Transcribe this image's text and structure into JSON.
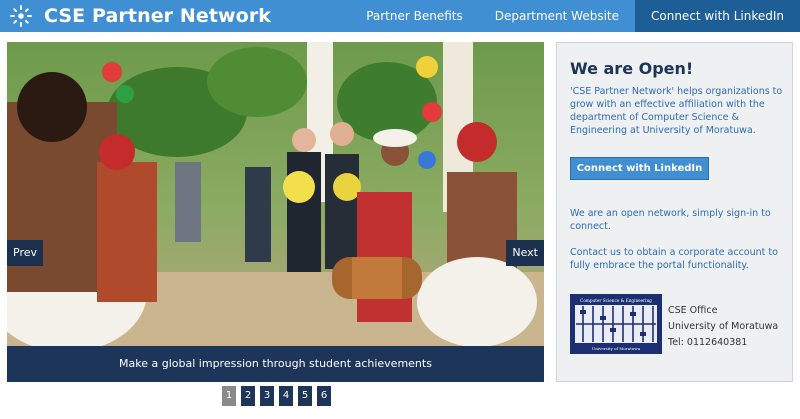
{
  "header": {
    "title": "CSE Partner Network",
    "logo_icon": "sunburst-icon",
    "nav": [
      {
        "label": "Partner Benefits"
      },
      {
        "label": "Department Website"
      },
      {
        "label": "Connect with LinkedIn"
      }
    ],
    "active_nav": "Connect with LinkedIn",
    "color": "#3f8fd2",
    "active_color": "#1e5e97"
  },
  "slider": {
    "prev_label": "Prev",
    "next_label": "Next",
    "caption": "Make a global impression through student achievements",
    "pages": [
      "1",
      "2",
      "3",
      "4",
      "5",
      "6"
    ],
    "current_page": "1",
    "image_icon": "photo-icon"
  },
  "panel": {
    "title": "We are Open!",
    "intro": "'CSE Partner Network' helps organizations to grow with an effective affiliation with the department of Computer Science & Engineering at University of Moratuwa.",
    "button_label": "Connect with LinkedIn",
    "open_text": "We are an open network, simply sign-in to connect.",
    "contact_text": "Contact us to obtain a corporate account to fully embrace the portal functionality.",
    "office": {
      "name": "CSE Office",
      "university": "University of Moratuwa",
      "tel": "Tel: 0112640381"
    },
    "logo_top": "Computer Science & Engineering",
    "logo_bottom": "University of Moratuwa"
  }
}
